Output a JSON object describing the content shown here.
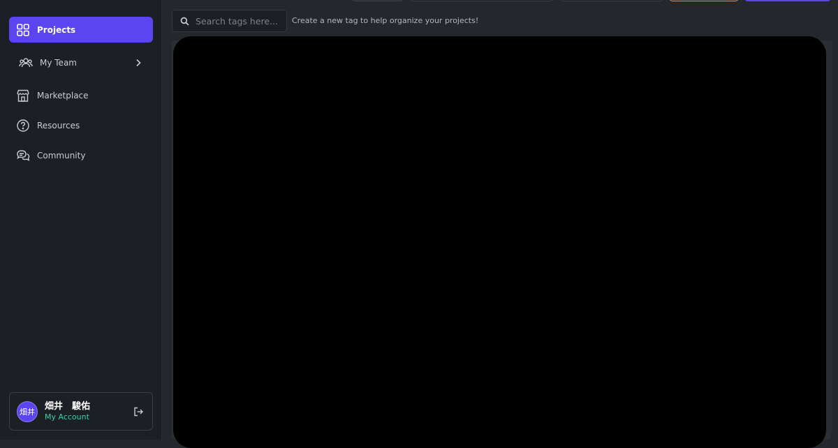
{
  "sidebar": {
    "items": [
      {
        "label": "Projects",
        "icon": "grid-icon",
        "active": true
      },
      {
        "label": "My Team",
        "icon": "team-icon",
        "has_submenu": true
      },
      {
        "label": "Marketplace",
        "icon": "store-icon"
      },
      {
        "label": "Resources",
        "icon": "help-circle-icon"
      },
      {
        "label": "Community",
        "icon": "chat-bubbles-icon"
      }
    ],
    "account": {
      "avatar_text": "畑井",
      "name": "畑井　駿佑",
      "link_label": "My Account"
    }
  },
  "toolbar": {
    "search_placeholder": "Search tags here...",
    "hint": "Create a new tag to help organize your projects!"
  },
  "colors": {
    "accent": "#5b45f0",
    "account_link": "#2fd6a3",
    "orange_button": "#f08a4b",
    "sidebar_bg": "#1c1f23",
    "page_bg": "#24272c"
  }
}
